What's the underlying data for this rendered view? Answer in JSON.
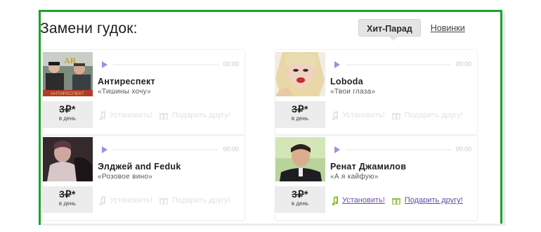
{
  "header": {
    "title": "Замени гудок:"
  },
  "tabs": [
    {
      "label": "Хит-Парад",
      "active": true
    },
    {
      "label": "Новинки",
      "active": false
    }
  ],
  "colors": {
    "frame": "#1aa32a",
    "play": "#a78be0",
    "price_bg": "#ececec",
    "link": "#6a4fa8",
    "note_active": "#8dbf3a"
  },
  "tracks": [
    {
      "artist": "Антиреспект",
      "song": "«Тишины хочу»",
      "time": "00:00",
      "price": "3₽",
      "price_suffix": "*",
      "period": "в день",
      "set_label": "Установить!",
      "gift_label": "Подарить другу!",
      "active": false,
      "cover_text": "АНТИРЕСПЕКТ"
    },
    {
      "artist": "Loboda",
      "song": "«Твои глаза»",
      "time": "00:00",
      "price": "3₽",
      "price_suffix": "*",
      "period": "в день",
      "set_label": "Установить!",
      "gift_label": "Подарить другу!",
      "active": false
    },
    {
      "artist": "Элджей and Feduk",
      "song": "«Розовое вино»",
      "time": "00:00",
      "price": "3₽",
      "price_suffix": "*",
      "period": "в день",
      "set_label": "Установить!",
      "gift_label": "Подарить другу!",
      "active": false
    },
    {
      "artist": "Ренат Джамилов",
      "song": "«А я кайфую»",
      "time": "00:00",
      "price": "3₽",
      "price_suffix": "*",
      "period": "в день",
      "set_label": "Установить!",
      "gift_label": "Подарить другу!",
      "active": true
    }
  ]
}
